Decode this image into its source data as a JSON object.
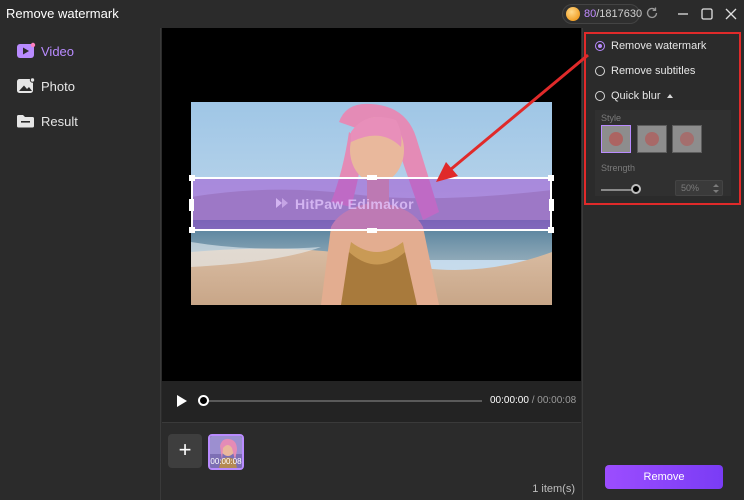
{
  "window": {
    "title": "Remove watermark"
  },
  "credits": {
    "used": "80",
    "total": "/1817630"
  },
  "sidebar": {
    "items": [
      {
        "label": "Video",
        "icon": "video-icon",
        "active": true
      },
      {
        "label": "Photo",
        "icon": "photo-icon",
        "active": false
      },
      {
        "label": "Result",
        "icon": "folder-icon",
        "active": false
      }
    ]
  },
  "preview": {
    "watermark_text": "HitPaw Edimakor"
  },
  "player": {
    "current_time": "00:00:00",
    "total_time": "/ 00:00:08"
  },
  "clips": {
    "add_label": "+",
    "thumb_time": "00:00:08",
    "count_text": "1 item(s)"
  },
  "options": {
    "remove_watermark": "Remove watermark",
    "remove_subtitles": "Remove subtitles",
    "quick_blur": "Quick blur",
    "selected": "remove_watermark",
    "style_label": "Style",
    "strength_label": "Strength",
    "strength_value": "50%",
    "strength_level": 0.5
  },
  "actions": {
    "remove_label": "Remove"
  },
  "colors": {
    "accent": "#b98bff",
    "highlight": "#e02a2a",
    "button": "#8b44f7"
  },
  "icons": [
    "coin-icon",
    "refresh-icon",
    "minimize-icon",
    "maximize-icon",
    "close-icon",
    "play-icon",
    "arrow-annotation"
  ]
}
